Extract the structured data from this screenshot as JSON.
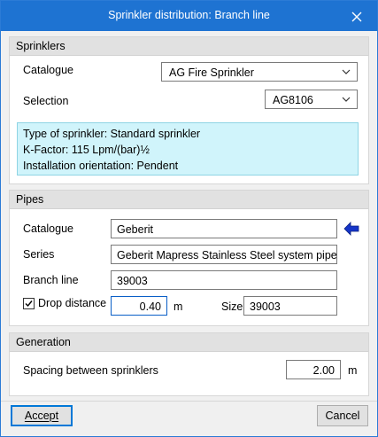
{
  "window": {
    "title": "Sprinkler distribution: Branch line",
    "close_icon": "close-icon"
  },
  "sprinklers": {
    "header": "Sprinklers",
    "catalogue_label": "Catalogue",
    "catalogue_value": "AG Fire Sprinkler",
    "selection_label": "Selection",
    "selection_value": "AG8106",
    "info": {
      "line1": "Type of sprinkler: Standard sprinkler",
      "line2": "K-Factor: 115 Lpm/(bar)½",
      "line3": "Installation orientation: Pendent"
    }
  },
  "pipes": {
    "header": "Pipes",
    "catalogue_label": "Catalogue",
    "catalogue_value": "Geberit",
    "series_label": "Series",
    "series_value": "Geberit Mapress Stainless Steel system pipe CrNiMo",
    "branch_label": "Branch line",
    "branch_value": "39003",
    "drop_label": "Drop distance",
    "drop_checked": true,
    "drop_value": "0.40",
    "drop_unit": "m",
    "size_label": "Size",
    "size_value": "39003"
  },
  "generation": {
    "header": "Generation",
    "spacing_label": "Spacing between sprinklers",
    "spacing_value": "2.00",
    "spacing_unit": "m"
  },
  "footer": {
    "accept_label": "Accept",
    "cancel_label": "Cancel"
  },
  "colors": {
    "titlebar": "#1e73d2",
    "info_bg": "#d0f4fb",
    "arrow": "#1535c8"
  }
}
